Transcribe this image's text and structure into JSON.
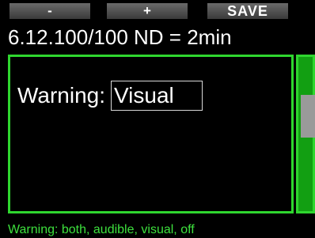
{
  "softkeys": {
    "minus": "-",
    "plus": "+",
    "save": "SAVE"
  },
  "title": "6.12.100/100 ND = 2min",
  "setting": {
    "label": "Warning:",
    "value": "Visual"
  },
  "help_text": "Warning: both, audible, visual, off",
  "colors": {
    "accent_green": "#2fd62f",
    "scroll_green": "#129f12",
    "background": "#000000"
  }
}
